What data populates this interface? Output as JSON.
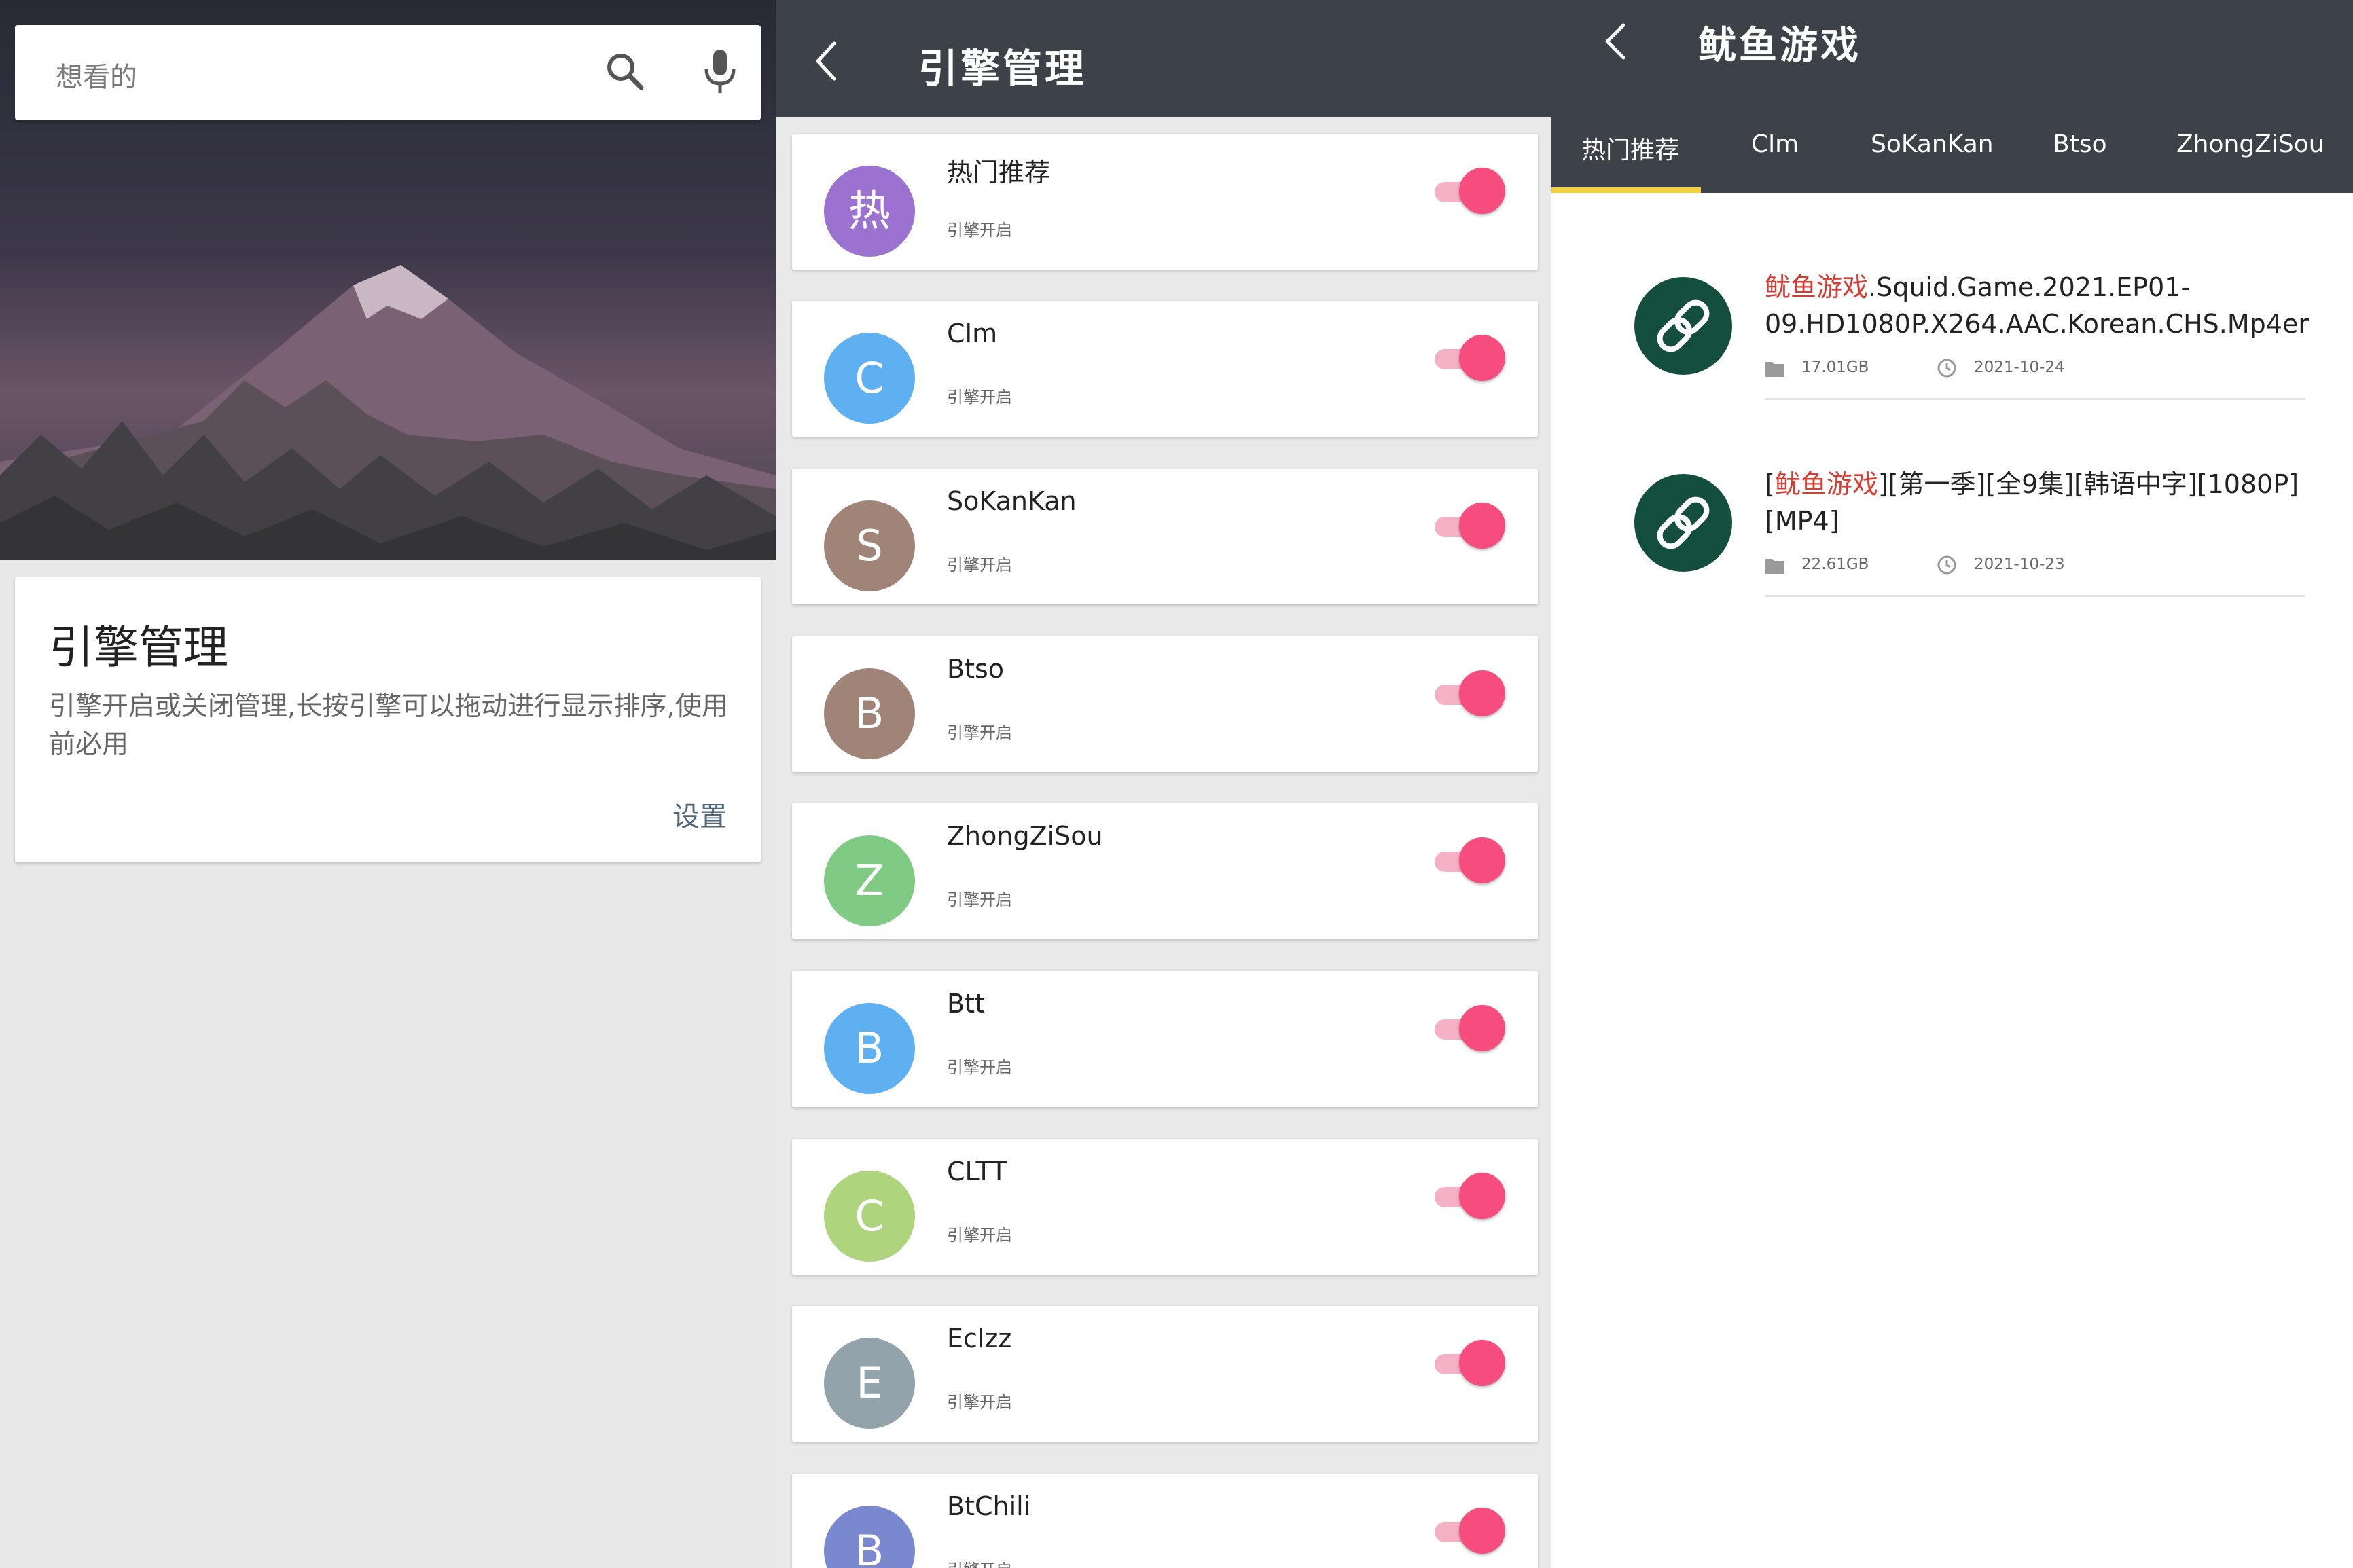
{
  "panel_search": {
    "search_placeholder": "想看的",
    "card_title": "引擎管理",
    "card_desc": "引擎开启或关闭管理,长按引擎可以拖动进行显示排序,使用前必用",
    "card_action": "设置"
  },
  "panel_engines": {
    "title": "引擎管理",
    "items": [
      {
        "letter": "热",
        "name": "热门推荐",
        "status": "引擎开启",
        "color": "#9b72d0",
        "enabled": true
      },
      {
        "letter": "C",
        "name": "Clm",
        "status": "引擎开启",
        "color": "#5fb0f0",
        "enabled": true
      },
      {
        "letter": "S",
        "name": "SoKanKan",
        "status": "引擎开启",
        "color": "#a08478",
        "enabled": true
      },
      {
        "letter": "B",
        "name": "Btso",
        "status": "引擎开启",
        "color": "#a08478",
        "enabled": true
      },
      {
        "letter": "Z",
        "name": "ZhongZiSou",
        "status": "引擎开启",
        "color": "#7fcb84",
        "enabled": true
      },
      {
        "letter": "B",
        "name": "Btt",
        "status": "引擎开启",
        "color": "#5fb0f0",
        "enabled": true
      },
      {
        "letter": "C",
        "name": "CLTT",
        "status": "引擎开启",
        "color": "#aed57e",
        "enabled": true
      },
      {
        "letter": "E",
        "name": "Eclzz",
        "status": "引擎开启",
        "color": "#92a3ab",
        "enabled": true
      },
      {
        "letter": "B",
        "name": "BtChili",
        "status": "引擎开启",
        "color": "#7a88cf",
        "enabled": true
      }
    ]
  },
  "panel_results": {
    "title": "鱿鱼游戏",
    "tabs": [
      "热门推荐",
      "Clm",
      "SoKanKan",
      "Btso",
      "ZhongZiSou"
    ],
    "active_tab": "热门推荐",
    "results": [
      {
        "title_pre": "",
        "title_hl": "鱿鱼游戏",
        "title_post": ".Squid.Game.2021.EP01-09.HD1080P.X264.AAC.Korean.CHS.Mp4er",
        "size": "17.01GB",
        "date": "2021-10-24"
      },
      {
        "title_pre": "[",
        "title_hl": "鱿鱼游戏",
        "title_post": "][第一季][全9集][韩语中字][1080P][MP4]",
        "size": "22.61GB",
        "date": "2021-10-23"
      }
    ]
  }
}
